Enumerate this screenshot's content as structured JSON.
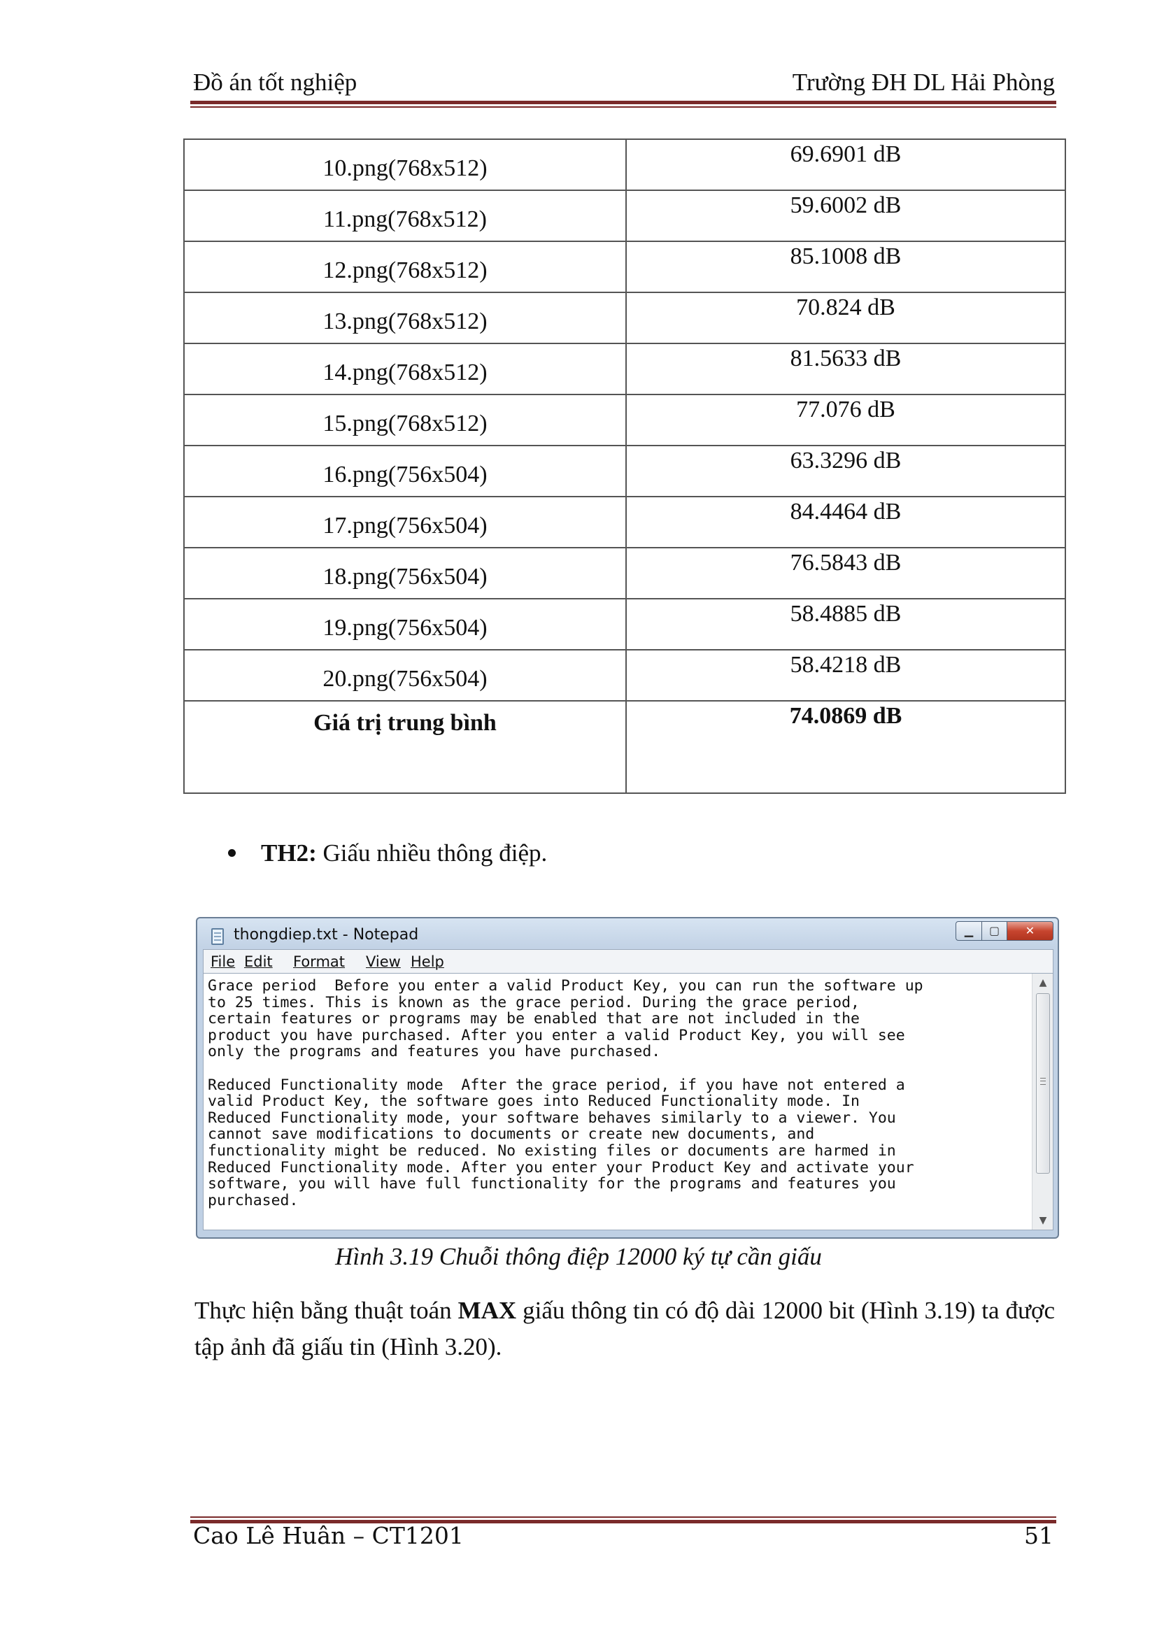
{
  "header": {
    "left": "Đồ án tốt nghiệp",
    "right": "Trường ĐH DL Hải Phòng"
  },
  "table": {
    "rows": [
      {
        "name": "10.png(768x512)",
        "value": "69.6901 dB"
      },
      {
        "name": "11.png(768x512)",
        "value": "59.6002 dB"
      },
      {
        "name": "12.png(768x512)",
        "value": "85.1008 dB"
      },
      {
        "name": "13.png(768x512)",
        "value": "70.824 dB"
      },
      {
        "name": "14.png(768x512)",
        "value": "81.5633 dB"
      },
      {
        "name": "15.png(768x512)",
        "value": "77.076 dB"
      },
      {
        "name": "16.png(756x504)",
        "value": "63.3296 dB"
      },
      {
        "name": "17.png(756x504)",
        "value": "84.4464 dB"
      },
      {
        "name": "18.png(756x504)",
        "value": "76.5843 dB"
      },
      {
        "name": "19.png(756x504)",
        "value": "58.4885 dB"
      },
      {
        "name": "20.png(756x504)",
        "value": "58.4218 dB"
      }
    ],
    "average": {
      "name": "Giá trị trung bình",
      "value": "74.0869 dB"
    }
  },
  "bullet": {
    "label": "TH2:",
    "text": " Giấu nhiều thông điệp."
  },
  "notepad": {
    "title": "thongdiep.txt - Notepad",
    "menu": {
      "file": "File",
      "edit": "Edit",
      "format": "Format",
      "view": "View",
      "help": "Help"
    },
    "content": "Grace period  Before you enter a valid Product Key, you can run the software up\nto 25 times. This is known as the grace period. During the grace period,\ncertain features or programs may be enabled that are not included in the\nproduct you have purchased. After you enter a valid Product Key, you will see\nonly the programs and features you have purchased.\n\nReduced Functionality mode  After the grace period, if you have not entered a\nvalid Product Key, the software goes into Reduced Functionality mode. In\nReduced Functionality mode, your software behaves similarly to a viewer. You\ncannot save modifications to documents or create new documents, and\nfunctionality might be reduced. No existing files or documents are harmed in\nReduced Functionality mode. After you enter your Product Key and activate your\nsoftware, you will have full functionality for the programs and features you\npurchased."
  },
  "caption": "Hình 3.19 Chuỗi thông điệp 12000 ký tự cần giấu",
  "paragraph": {
    "part1": "Thực hiện bằng thuật toán ",
    "bold": "MAX",
    "part2": " giấu thông tin có độ dài 12000 bit (Hình 3.19) ta được tập ảnh đã giấu tin (Hình 3.20)."
  },
  "footer": {
    "left": "Cao Lê Huân – CT1201",
    "right": "51"
  }
}
